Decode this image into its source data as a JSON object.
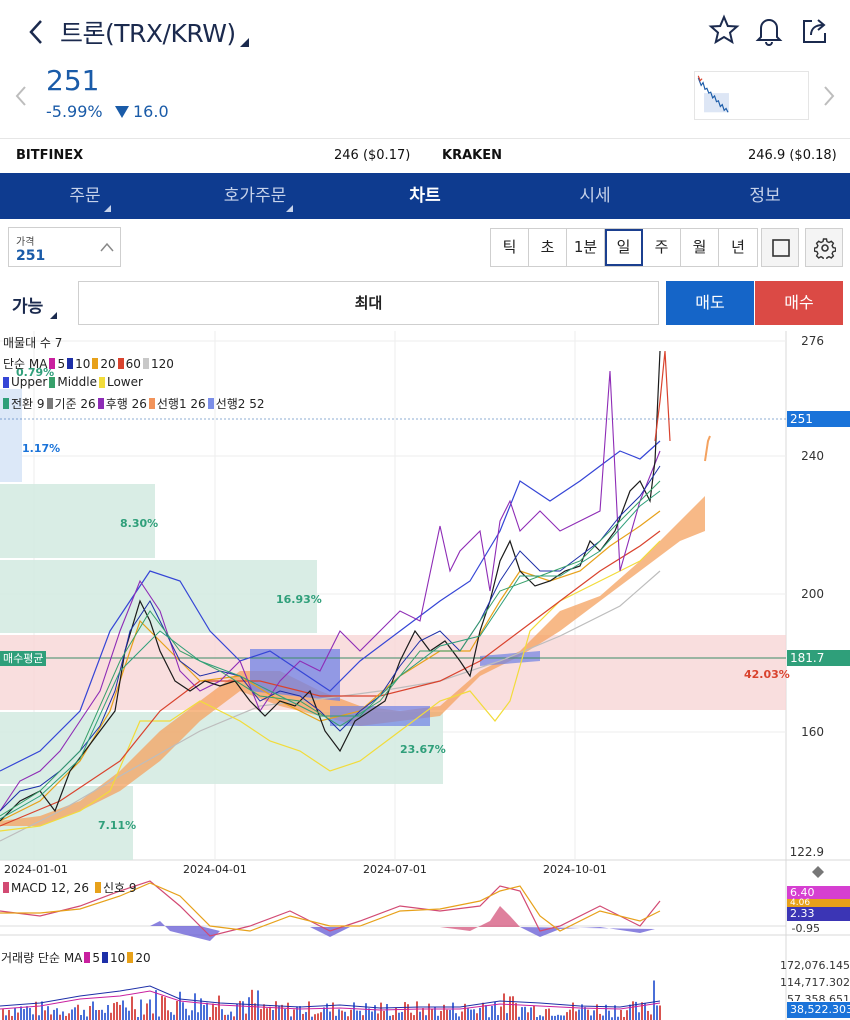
{
  "header": {
    "title": "트론(TRX/KRW)"
  },
  "ticker": {
    "price": "251",
    "change_pct": "-5.99%",
    "change_val": "16.0"
  },
  "exchanges": [
    {
      "name": "BITFINEX",
      "value": "246 ($0.17)"
    },
    {
      "name": "KRAKEN",
      "value": "246.9 ($0.18)"
    }
  ],
  "tabs": [
    {
      "label": "주문",
      "has_menu": true
    },
    {
      "label": "호가주문",
      "has_menu": true
    },
    {
      "label": "차트",
      "has_menu": false,
      "active": true
    },
    {
      "label": "시세",
      "has_menu": false
    },
    {
      "label": "정보",
      "has_menu": false
    }
  ],
  "toolbar": {
    "price_label": "가격",
    "price_value": "251",
    "periods": [
      "틱",
      "초",
      "1분",
      "일",
      "주",
      "월",
      "년"
    ],
    "active_period": "일"
  },
  "order": {
    "available": "가능",
    "max": "최대",
    "sell": "매도",
    "buy": "매수"
  },
  "chart": {
    "legend": {
      "volume_profile": "매물대 수 7",
      "ma_label": "단순 MA",
      "ma": [
        {
          "name": "5",
          "color": "#c9209f"
        },
        {
          "name": "10",
          "color": "#1d2fa8"
        },
        {
          "name": "20",
          "color": "#e7a11a"
        },
        {
          "name": "60",
          "color": "#d9432e"
        },
        {
          "name": "120",
          "color": "#c8c8c8"
        }
      ],
      "bb": [
        {
          "name": "Upper",
          "color": "#3545d6"
        },
        {
          "name": "Middle",
          "color": "#37a06a"
        },
        {
          "name": "Lower",
          "color": "#f2dc3a"
        }
      ],
      "ichimoku": [
        {
          "name": "전환 9",
          "color": "#2f9f7a"
        },
        {
          "name": "기준 26",
          "color": "#7a7a7a"
        },
        {
          "name": "후행 26",
          "color": "#8e2cb6"
        },
        {
          "name": "선행1 26",
          "color": "#f2935a"
        },
        {
          "name": "선행2 52",
          "color": "#7b8ee8"
        }
      ]
    },
    "y_labels": [
      "276",
      "240",
      "200",
      "160",
      "122.9"
    ],
    "current_price_label": "251",
    "avg_label": "매수평균",
    "avg_value": "181.7",
    "avg_pct": "42.03%",
    "zone_pcts": [
      "0.79%",
      "1.17%",
      "8.30%",
      "16.93%",
      "23.67%",
      "7.11%"
    ],
    "x_labels": [
      "2024-01-01",
      "2024-04-01",
      "2024-07-01",
      "2024-10-01"
    ],
    "macd": {
      "label": "MACD 12, 26",
      "signal_label": "신호 9",
      "values": [
        "6.40",
        "4.06",
        "2.33"
      ],
      "bottom_label": "-0.95"
    },
    "volume": {
      "label": "거래량 단순 MA",
      "ma": [
        "5",
        "10",
        "20"
      ],
      "values": [
        "172,076.145",
        "114,717.302",
        "57,358.651",
        "38,522.303"
      ]
    }
  },
  "colors": {
    "brand": "#0e3b8f",
    "up": "#db4a45",
    "down": "#1a5ba8",
    "sell": "#1565c8",
    "buy": "#db4a45"
  }
}
